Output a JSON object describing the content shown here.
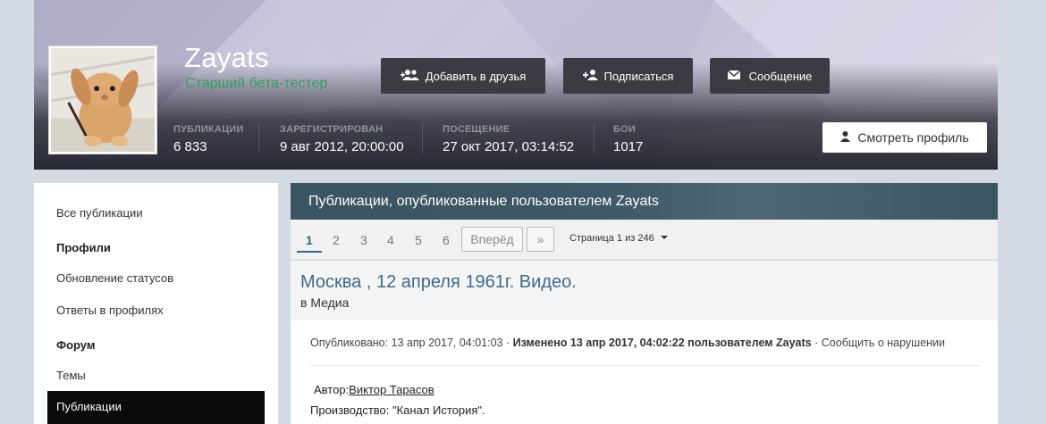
{
  "profile": {
    "username": "Zayats",
    "group": "Старший бета-тестер",
    "buttons": {
      "add_friend": "Добавить в друзья",
      "follow": "Подписаться",
      "message": "Сообщение",
      "view_profile": "Смотреть профиль"
    },
    "stats": [
      {
        "label": "ПУБЛИКАЦИИ",
        "value": "6 833"
      },
      {
        "label": "ЗАРЕГИСТРИРОВАН",
        "value": "9 авг 2012, 20:00:00"
      },
      {
        "label": "ПОСЕЩЕНИЕ",
        "value": "27 окт 2017, 03:14:52"
      },
      {
        "label": "БОИ",
        "value": "1017"
      }
    ],
    "colors": {
      "group": "#2fa15e",
      "button_bg": "#3b3c43"
    },
    "icons": {
      "add_friend": "users-plus-icon",
      "follow": "user-plus-icon",
      "message": "envelope-icon",
      "view_profile": "user-icon"
    }
  },
  "sidebar": {
    "all_posts": "Все публикации",
    "profiles_heading": "Профили",
    "status_updates": "Обновление статусов",
    "profile_replies": "Ответы в профилях",
    "forum_heading": "Форум",
    "topics": "Темы",
    "posts": "Публикации"
  },
  "main": {
    "heading": "Публикации, опубликованные пользователем Zayats",
    "pagination": {
      "pages": [
        "1",
        "2",
        "3",
        "4",
        "5",
        "6"
      ],
      "current": "1",
      "next": "Вперёд",
      "last": "»",
      "info": "Страница 1 из 246"
    },
    "post": {
      "title": "Москва , 12 апреля 1961г. Видео.",
      "in_prefix": "в",
      "in_forum": "Медиа",
      "published": "Опубликовано: 13 апр 2017, 04:01:03",
      "sep1": "·",
      "edited": "Изменено 13 апр 2017, 04:02:22 пользователем Zayats",
      "sep2": "·",
      "report": "Сообщить о нарушении",
      "author_label": "Автор:",
      "author_name": "Виктор Тарасов",
      "production": "Производство: \"Канал История\"."
    }
  }
}
